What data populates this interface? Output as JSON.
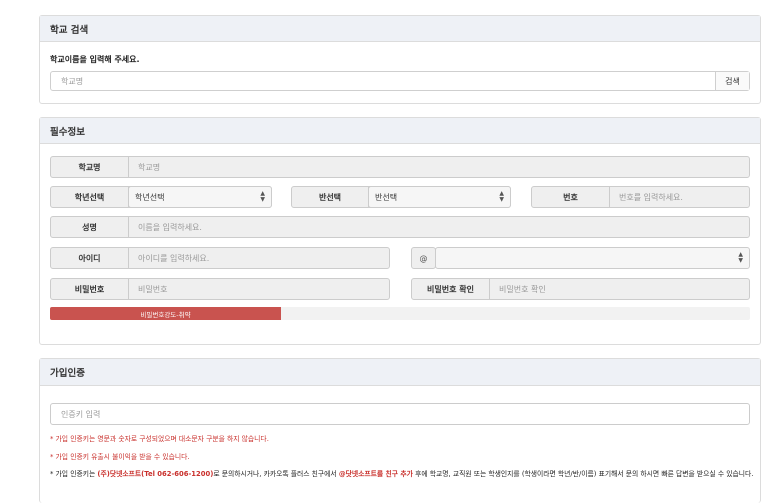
{
  "school_search": {
    "title": "학교 검색",
    "prompt": "학교이름을 입력해 주세요.",
    "placeholder": "학교명",
    "search_button": "검색"
  },
  "required_info": {
    "title": "필수정보",
    "school": {
      "label": "학교명",
      "placeholder": "학교명"
    },
    "grade": {
      "label": "학년선택",
      "selected": "학년선택"
    },
    "class": {
      "label": "반선택",
      "selected": "반선택"
    },
    "number": {
      "label": "번호",
      "placeholder": "번호를 입력하세요."
    },
    "name": {
      "label": "성명",
      "placeholder": "이름을 입력하세요."
    },
    "userid": {
      "label": "아이디",
      "placeholder": "아이디를 입력하세요.",
      "at": "@"
    },
    "password": {
      "label": "비밀번호",
      "placeholder": "비밀번호"
    },
    "password_confirm": {
      "label": "비밀번호 확인",
      "placeholder": "비밀번호 확인"
    },
    "strength": {
      "text": "비밀번호강도-취약",
      "level": 0.33,
      "color": "#c9534f"
    }
  },
  "join_auth": {
    "title": "가입인증",
    "placeholder": "인증키 입력",
    "note1": "* 가입 인증키는 영문과 숫자로 구성되었으며 대소문자 구분을 하지 않습니다.",
    "note2": "* 가입 인증키 유출시 불이익을 받을 수 있습니다.",
    "note3_a": "* 가입 인증키는 ",
    "note3_company": "(주)닷넷소프트(Tel 062-606-1200)",
    "note3_b": "로 문의하시거나, 카카오톡 플러스 친구에서 ",
    "note3_friend": "@닷넷소프트를 친구 추가",
    "note3_c": " 후에 학교명, 교직원 또는 학생인지를 (학생이라면 학년/반/이름) 표기해서 문의 하시면 빠른 답변을 받으실 수 있습니다."
  }
}
